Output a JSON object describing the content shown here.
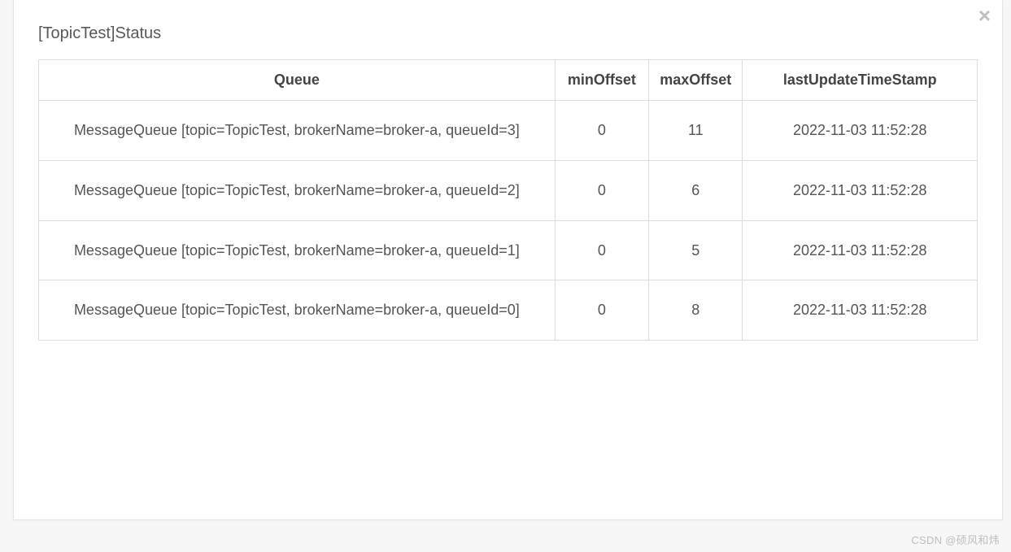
{
  "modal": {
    "title": "[TopicTest]Status",
    "close_label": "×"
  },
  "table": {
    "headers": {
      "queue": "Queue",
      "minOffset": "minOffset",
      "maxOffset": "maxOffset",
      "lastUpdateTimeStamp": "lastUpdateTimeStamp"
    },
    "rows": [
      {
        "queue": "MessageQueue [topic=TopicTest, brokerName=broker-a, queueId=3]",
        "minOffset": "0",
        "maxOffset": "11",
        "lastUpdateTimeStamp": "2022-11-03 11:52:28"
      },
      {
        "queue": "MessageQueue [topic=TopicTest, brokerName=broker-a, queueId=2]",
        "minOffset": "0",
        "maxOffset": "6",
        "lastUpdateTimeStamp": "2022-11-03 11:52:28"
      },
      {
        "queue": "MessageQueue [topic=TopicTest, brokerName=broker-a, queueId=1]",
        "minOffset": "0",
        "maxOffset": "5",
        "lastUpdateTimeStamp": "2022-11-03 11:52:28"
      },
      {
        "queue": "MessageQueue [topic=TopicTest, brokerName=broker-a, queueId=0]",
        "minOffset": "0",
        "maxOffset": "8",
        "lastUpdateTimeStamp": "2022-11-03 11:52:28"
      }
    ]
  },
  "watermark": "CSDN @硕风和炜"
}
